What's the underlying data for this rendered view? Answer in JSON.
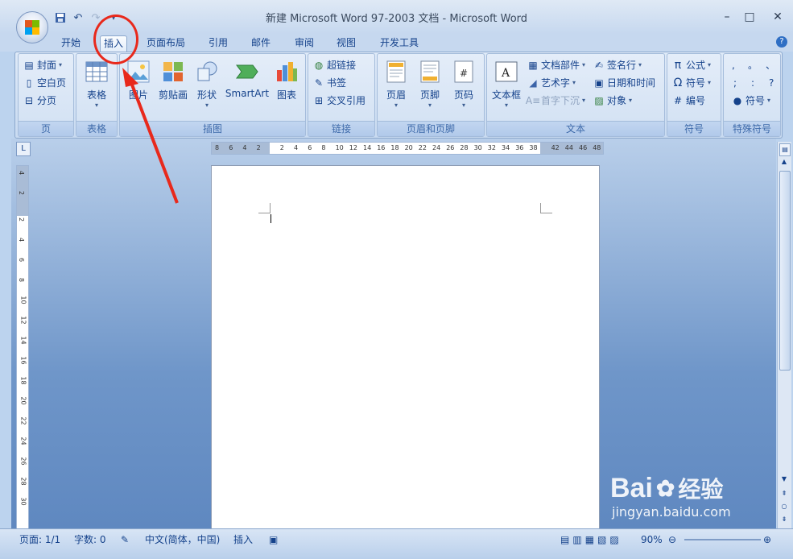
{
  "window": {
    "title": "新建 Microsoft Word 97-2003 文档 - Microsoft Word",
    "minimize": "–",
    "maximize": "□",
    "close": "✕"
  },
  "quick_access": [
    "save-icon",
    "undo-icon",
    "redo-icon",
    "customize-icon"
  ],
  "tabs": [
    {
      "label": "开始"
    },
    {
      "label": "插入"
    },
    {
      "label": "页面布局"
    },
    {
      "label": "引用"
    },
    {
      "label": "邮件"
    },
    {
      "label": "审阅"
    },
    {
      "label": "视图"
    },
    {
      "label": "开发工具"
    }
  ],
  "help": "?",
  "ribbon": {
    "pages": {
      "label": "页",
      "cover": "封面",
      "blank": "空白页",
      "break": "分页"
    },
    "tables": {
      "label": "表格",
      "table": "表格"
    },
    "illustrations": {
      "label": "插图",
      "picture": "图片",
      "clipart": "剪贴画",
      "shapes": "形状",
      "smartart": "SmartArt",
      "chart": "图表"
    },
    "links": {
      "label": "链接",
      "hyperlink": "超链接",
      "bookmark": "书签",
      "crossref": "交叉引用"
    },
    "header_footer": {
      "label": "页眉和页脚",
      "header": "页眉",
      "footer": "页脚",
      "pagenum": "页码"
    },
    "text": {
      "label": "文本",
      "textbox": "文本框",
      "quickparts": "文档部件",
      "wordart": "艺术字",
      "dropcap": "首字下沉",
      "signature": "签名行",
      "datetime": "日期和时间",
      "object": "对象"
    },
    "symbols": {
      "label": "符号",
      "equation": "公式",
      "symbol": "符号",
      "number": "编号"
    },
    "special": {
      "label": "特殊符号",
      "symbol": "符号",
      "chars": [
        ",",
        "。",
        "、",
        ";",
        ":",
        "?"
      ]
    }
  },
  "ruler": {
    "horizontal": [
      "8",
      "6",
      "4",
      "2",
      "2",
      "4",
      "6",
      "8",
      "10",
      "12",
      "14",
      "16",
      "18",
      "20",
      "22",
      "24",
      "26",
      "28",
      "30",
      "32",
      "34",
      "36",
      "38",
      "42",
      "44",
      "46",
      "48"
    ],
    "vertical": [
      "4",
      "2",
      "2",
      "4",
      "6",
      "8",
      "10",
      "12",
      "14",
      "16",
      "18",
      "20",
      "22",
      "24",
      "26",
      "28",
      "30"
    ]
  },
  "status": {
    "page": "页面: 1/1",
    "words": "字数: 0",
    "language": "中文(简体，中国)",
    "mode": "插入",
    "zoom": "90%"
  },
  "watermark": {
    "brand": "Bai",
    "brand2": "经验",
    "url": "jingyan.baidu.com"
  },
  "colors": {
    "annotation": "#e8291c",
    "ribbon_text": "#15428b"
  }
}
